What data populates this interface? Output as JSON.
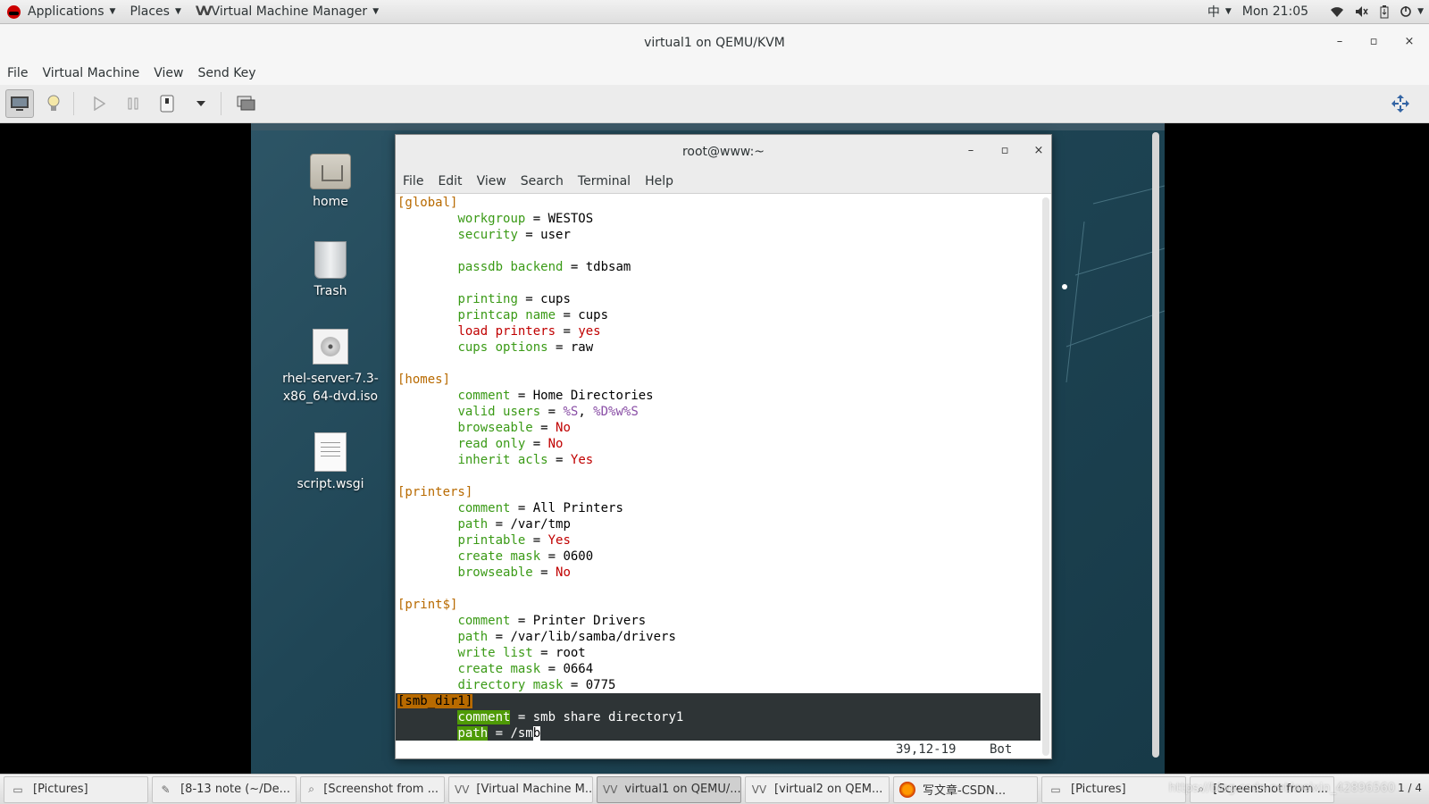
{
  "topbar": {
    "applications": "Applications",
    "places": "Places",
    "app_name": "Virtual Machine Manager",
    "input_method": "中",
    "clock": "Mon 21:05"
  },
  "window": {
    "title": "virtual1 on QEMU/KVM",
    "minimize": "–",
    "maximize": "▫",
    "close": "×"
  },
  "menu": {
    "file": "File",
    "virtual_machine": "Virtual Machine",
    "view": "View",
    "send_key": "Send Key"
  },
  "desktop": {
    "icons": [
      {
        "label": "home"
      },
      {
        "label": "Trash"
      },
      {
        "label": "rhel-server-7.3-x86_64-dvd.iso"
      },
      {
        "label": "script.wsgi"
      }
    ]
  },
  "terminal": {
    "title": "root@www:~",
    "menu": [
      "File",
      "Edit",
      "View",
      "Search",
      "Terminal",
      "Help"
    ],
    "status_pos": "39,12-19",
    "status_scroll": "Bot",
    "lines": {
      "global": "[global]",
      "workgroup_k": "workgroup",
      "workgroup_v": " = WESTOS",
      "security_k": "security",
      "security_v": " = user",
      "passdb_k": "passdb backend",
      "passdb_v": " = tdbsam",
      "printing_k": "printing",
      "printing_v": " = cups",
      "printcap_k": "printcap name",
      "printcap_v": " = cups",
      "load_k": "load printers",
      "load_eq": " = ",
      "load_v": "yes",
      "cupsopt_k": "cups options",
      "cupsopt_v": " = raw",
      "homes": "[homes]",
      "h_comment_k": "comment",
      "h_comment_v": " = Home Directories",
      "h_valid_k": "valid users",
      "h_valid_eq": " = ",
      "h_valid_v1": "%S",
      "h_valid_sep": ", ",
      "h_valid_v2": "%D%w%S",
      "h_browse_k": "browseable",
      "h_browse_eq": " = ",
      "h_browse_v": "No",
      "h_ro_k": "read only",
      "h_ro_eq": " = ",
      "h_ro_v": "No",
      "h_acls_k": "inherit acls",
      "h_acls_eq": " = ",
      "h_acls_v": "Yes",
      "printers": "[printers]",
      "p_comment_k": "comment",
      "p_comment_v": " = All Printers",
      "p_path_k": "path",
      "p_path_v": " = /var/tmp",
      "p_printable_k": "printable",
      "p_printable_eq": " = ",
      "p_printable_v": "Yes",
      "p_mask_k": "create mask",
      "p_mask_v": " = 0600",
      "p_browse_k": "browseable",
      "p_browse_eq": " = ",
      "p_browse_v": "No",
      "print_s": "[print$]",
      "d_comment_k": "comment",
      "d_comment_v": " = Printer Drivers",
      "d_path_k": "path",
      "d_path_v": " = /var/lib/samba/drivers",
      "d_write_k": "write list",
      "d_write_v": " = root",
      "d_mask_k": "create mask",
      "d_mask_v": " = 0664",
      "d_dirmask_k": "directory mask",
      "d_dirmask_v": " = 0775",
      "smb": "[smb_dir1]",
      "s_comment_k": "comment",
      "s_comment_v": " = smb share directory1",
      "s_path_k": "path",
      "s_path_v": " = /sm",
      "s_path_cursor": "b"
    }
  },
  "taskbar": {
    "items": [
      "[Pictures]",
      "[8-13 note (~/De...",
      "[Screenshot from ...",
      "[Virtual Machine M...",
      "virtual1 on QEMU/...",
      "[virtual2 on QEM...",
      "写文章-CSDN...",
      "[Pictures]",
      "[Screenshot from ..."
    ],
    "watermark": "https://blog.csdn.net/weixin_42896560",
    "pager": "1 / 4"
  },
  "colors": {
    "config_key": "#3a9a16",
    "config_value_keyword": "#c00000",
    "section_header": "#b86a00",
    "macro": "#8a4fa6",
    "guest_background": "#1f4555"
  }
}
